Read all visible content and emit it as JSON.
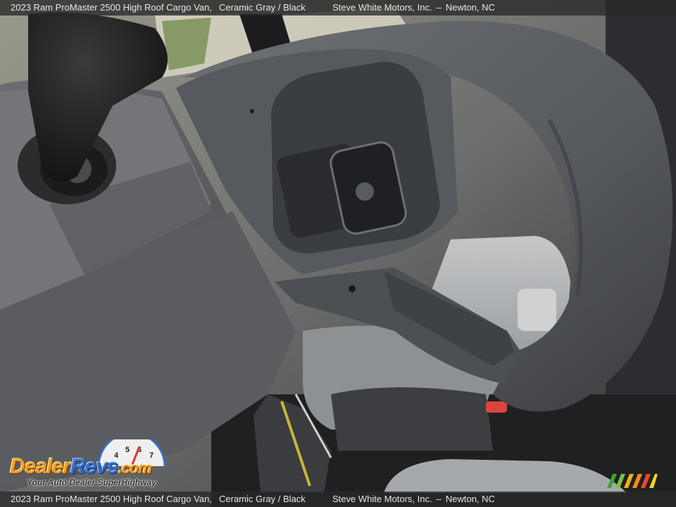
{
  "caption": {
    "title": "2023 Ram ProMaster 2500 High Roof Cargo Van,",
    "color": "Ceramic Gray / Black",
    "dealer": "Steve White Motors, Inc.",
    "separator": "–",
    "location": "Newton, NC"
  },
  "watermark": {
    "brand_part1": "Dealer",
    "brand_part2": "Revs",
    "brand_part3": ".com",
    "tagline": "Your Auto Dealer SuperHighway",
    "gauge_numbers": [
      "4",
      "5",
      "6",
      "7"
    ]
  },
  "colors": {
    "caption_bar": "#282828",
    "wheel_gray": "#5a5d61",
    "logo_orange": "#f39c1f",
    "logo_blue": "#2f6fd0"
  }
}
